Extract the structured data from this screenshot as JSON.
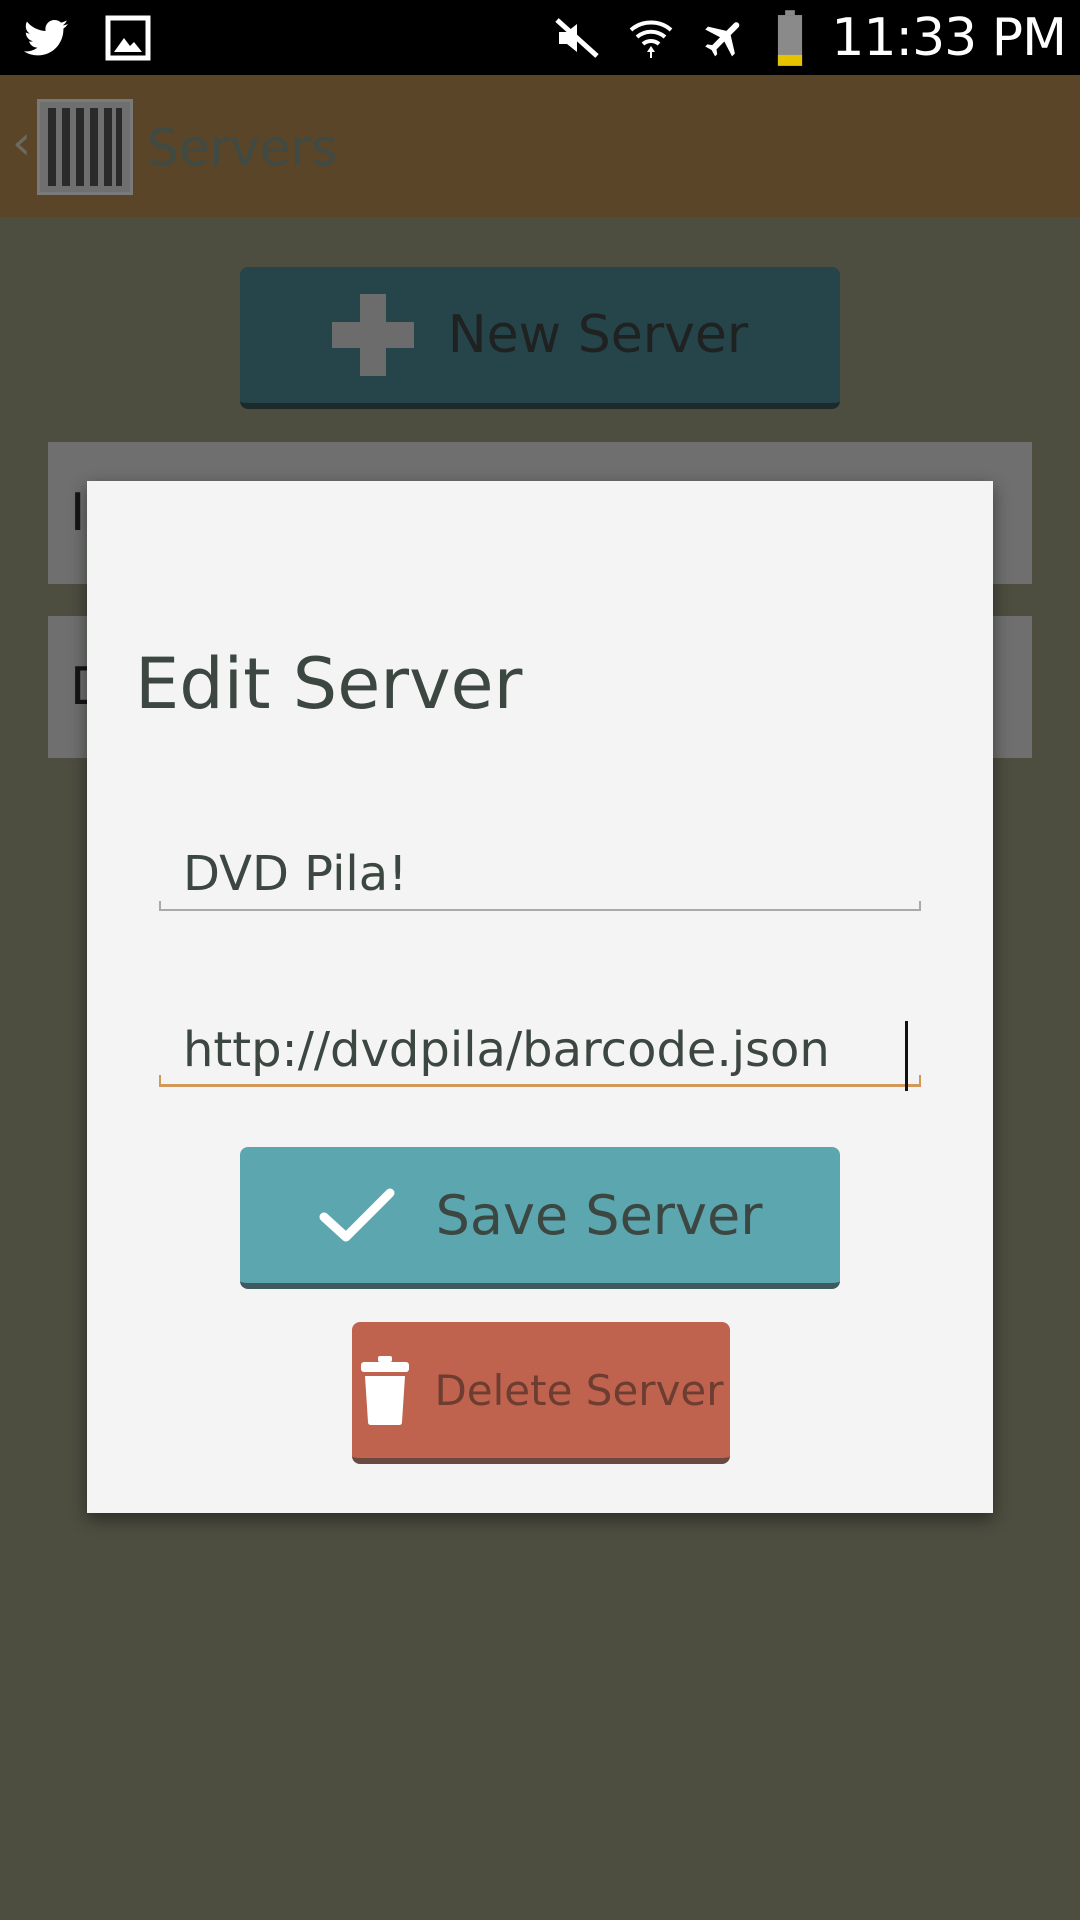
{
  "status_bar": {
    "time": "11:33 PM",
    "icons": [
      "twitter-icon",
      "image-icon",
      "mute-icon",
      "wifi-icon",
      "airplane-mode-icon",
      "battery-icon"
    ]
  },
  "app_bar": {
    "title": "Servers",
    "back_glyph": "‹"
  },
  "background": {
    "new_server_label": "New Server",
    "row1_text": "I",
    "row2_text": "D"
  },
  "dialog": {
    "title": "Edit Server",
    "name_value": "DVD Pila!",
    "url_value": "http://dvdpila/barcode.json",
    "save_label": "Save Server",
    "delete_label": "Delete Server"
  },
  "colors": {
    "app_bar": "#5a4529",
    "save_button": "#5ca6b0",
    "delete_button": "#c0634e",
    "active_underline": "#d19a5a"
  }
}
